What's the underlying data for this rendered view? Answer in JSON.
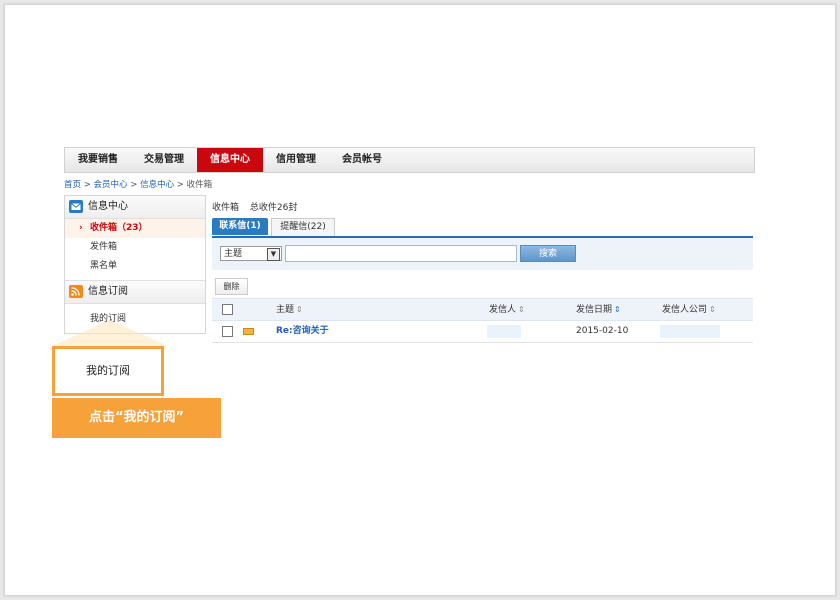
{
  "nav": {
    "items": [
      {
        "label": "我要销售"
      },
      {
        "label": "交易管理"
      },
      {
        "label": "信息中心",
        "active": true
      },
      {
        "label": "信用管理"
      },
      {
        "label": "会员帐号"
      }
    ]
  },
  "breadcrumb": {
    "home": "首页",
    "sep1": " > ",
    "member": "会员中心",
    "sep2": " > ",
    "info": "信息中心",
    "sep3": " > ",
    "current": "收件箱"
  },
  "sidebar": {
    "section1_title": "信息中心",
    "items": [
      {
        "label": "收件箱（23）",
        "active": true
      },
      {
        "label": "发件箱"
      },
      {
        "label": "黑名单"
      }
    ],
    "section2_title": "信息订阅",
    "sub_item": "我的订阅"
  },
  "main": {
    "title": "收件箱",
    "total": "总收件26封",
    "tabs": [
      {
        "label": "联系信(1)"
      },
      {
        "label": "提醒信(22)"
      }
    ],
    "search_select": "主题",
    "search_button": "搜索",
    "delete_button": "删除"
  },
  "table": {
    "headers": [
      "主题",
      "发信人",
      "发信日期",
      "发信人公司"
    ],
    "rows": [
      {
        "subject": "Re:咨询关于",
        "sender": "",
        "date": "2015-02-10",
        "company": ""
      }
    ]
  },
  "callout": {
    "box_text": "我的订阅",
    "label": "点击“我的订阅”"
  },
  "colors": {
    "accent_red": "#c8080e",
    "tab_blue": "#2b7bc3",
    "callout_orange": "#f6a13a"
  }
}
